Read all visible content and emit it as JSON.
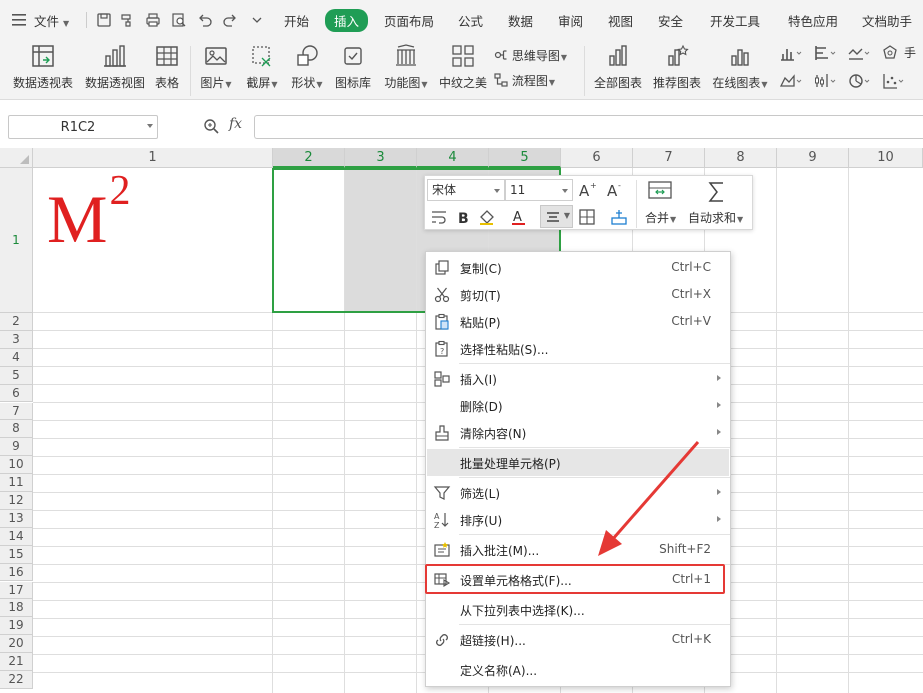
{
  "menubar": {
    "file_label": "文件",
    "tabs": [
      "开始",
      "插入",
      "页面布局",
      "公式",
      "数据",
      "审阅",
      "视图",
      "安全",
      "开发工具",
      "特色应用",
      "文档助手"
    ],
    "active_tab": "插入"
  },
  "ribbon": {
    "pivot_table": "数据透视表",
    "pivot_chart": "数据透视图",
    "table": "表格",
    "picture": "图片",
    "screenshot": "截屏",
    "shape": "形状",
    "icon_lib": "图标库",
    "func_chart": "功能图",
    "zhongwen": "中纹之美",
    "mindmap": "思维导图",
    "flowchart": "流程图",
    "all_charts": "全部图表",
    "recommended_charts": "推荐图表",
    "online_charts": "在线图表"
  },
  "formula_bar": {
    "name_box": "R1C2",
    "fx_label": "fx",
    "formula": ""
  },
  "sheet": {
    "columns": [
      "1",
      "2",
      "3",
      "4",
      "5",
      "6",
      "7",
      "8",
      "9",
      "10"
    ],
    "rows": [
      "1",
      "2",
      "3",
      "4",
      "5",
      "6",
      "7",
      "8",
      "9",
      "10",
      "11",
      "12",
      "13",
      "14",
      "15",
      "16",
      "17",
      "18",
      "19",
      "20",
      "21",
      "22"
    ],
    "cell_main": "M",
    "cell_sup": "2"
  },
  "mini_toolbar": {
    "font_name": "宋体",
    "font_size": "11",
    "merge_label": "合并",
    "autosum_label": "自动求和"
  },
  "context_menu": {
    "copy": {
      "label": "复制(C)",
      "shortcut": "Ctrl+C"
    },
    "cut": {
      "label": "剪切(T)",
      "shortcut": "Ctrl+X"
    },
    "paste": {
      "label": "粘贴(P)",
      "shortcut": "Ctrl+V"
    },
    "paste_special": {
      "label": "选择性粘贴(S)..."
    },
    "insert": {
      "label": "插入(I)"
    },
    "delete": {
      "label": "删除(D)"
    },
    "clear": {
      "label": "清除内容(N)"
    },
    "batch": {
      "label": "批量处理单元格(P)"
    },
    "filter": {
      "label": "筛选(L)"
    },
    "sort": {
      "label": "排序(U)"
    },
    "comment": {
      "label": "插入批注(M)...",
      "shortcut": "Shift+F2"
    },
    "format_cells": {
      "label": "设置单元格格式(F)...",
      "shortcut": "Ctrl+1"
    },
    "pick_list": {
      "label": "从下拉列表中选择(K)..."
    },
    "hyperlink": {
      "label": "超链接(H)...",
      "shortcut": "Ctrl+K"
    },
    "define_name": {
      "label": "定义名称(A)..."
    }
  },
  "colors": {
    "accent_green": "#1f9d55",
    "selection_green": "#2ea043",
    "highlight_red": "#e53935",
    "cell_text_red": "#e02020"
  }
}
